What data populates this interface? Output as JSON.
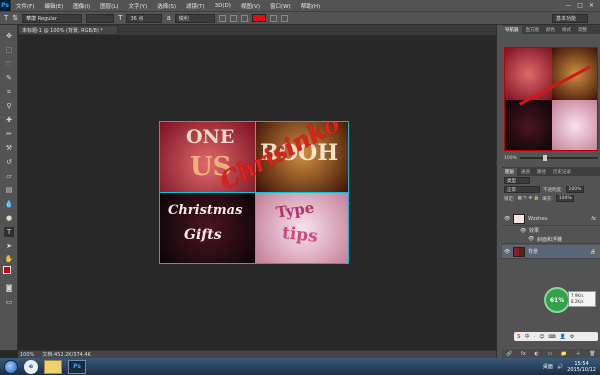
{
  "app": {
    "logo": "Ps"
  },
  "menubar": {
    "items": [
      "文件(F)",
      "编辑(E)",
      "图像(I)",
      "图层(L)",
      "文字(Y)",
      "选择(S)",
      "滤镜(T)",
      "3D(D)",
      "视图(V)",
      "窗口(W)",
      "帮助(H)"
    ],
    "controls": [
      "—",
      "□",
      "✕"
    ]
  },
  "options": {
    "tool_glyph": "T",
    "orient_glyph": "⇅",
    "font_family": "華康 Regular",
    "size_glyph": "T",
    "font_size": "36 点",
    "aa_glyph": "a",
    "antialias": "锐利",
    "text_color": "#e01010",
    "workspace": "基本功能"
  },
  "document": {
    "tab_title": "未标题-1 @ 100% (背景, RGB/8) *",
    "watermark": "Chrisinko",
    "tiles": [
      {
        "text_top": "ONE",
        "text_bottom": "US"
      },
      {
        "text_top": "BOOH"
      },
      {
        "text_top": "Christmas",
        "text_bottom": "Gifts"
      },
      {
        "text_top": "Type",
        "text_bottom": "tips"
      }
    ]
  },
  "status": {
    "zoom": "100%",
    "doc_size": "文档:452.2K/374.4K"
  },
  "panel": {
    "top_tabs": [
      "导航器",
      "直方图",
      "颜色",
      "样式",
      "调整"
    ],
    "active_top": "导航器",
    "nav_zoom": "100%",
    "layer_tabs": [
      "图层",
      "通道",
      "路径",
      "历史记录"
    ],
    "active_layer_tab": "图层",
    "filter_kind": "类型",
    "blend_mode": "正常",
    "opacity_label": "不透明度:",
    "opacity": "100%",
    "lock_label": "锁定:",
    "fill_label": "填充:",
    "fill": "100%",
    "layers": [
      {
        "name": "Wzsheu",
        "fx": "fx",
        "selected": false
      },
      {
        "name": "效果",
        "sub": true
      },
      {
        "name": "斜面和浮雕",
        "sub": true,
        "eye": "👁"
      },
      {
        "name": "背景",
        "selected": true,
        "lock": "🔒"
      }
    ],
    "net_widget": "61%",
    "net_up": "7.9K/s",
    "net_down": "8.2K/s",
    "ime_label": "S",
    "ime_items": [
      "中",
      "·",
      "😊",
      "⌨",
      "👤",
      "⚙"
    ],
    "footer_icons": [
      "🔗",
      "fx",
      "◐",
      "▭",
      "📁",
      "＋",
      "🗑"
    ]
  },
  "taskbar": {
    "ps_label": "Ps",
    "tray_text": "桌面",
    "time": "15:54",
    "date": "2015/10/12"
  }
}
